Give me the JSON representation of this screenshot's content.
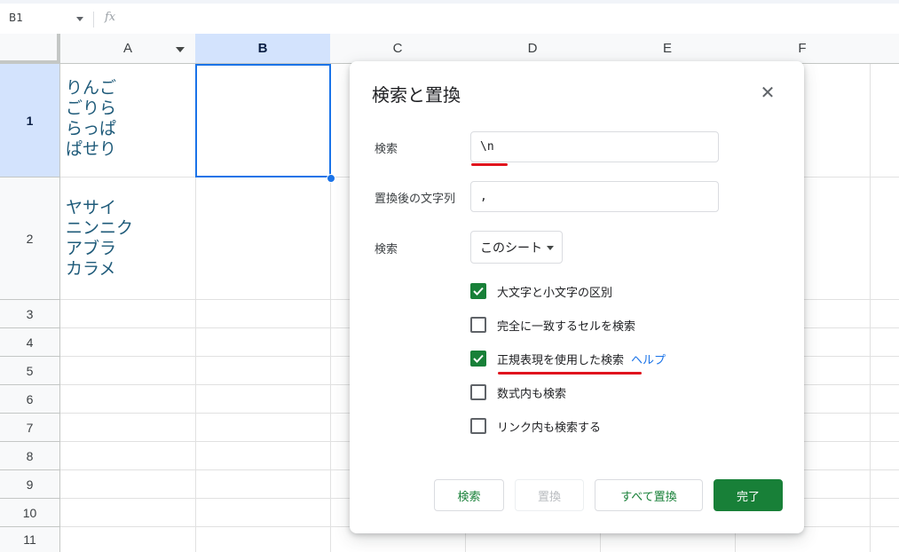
{
  "formula_bar": {
    "cell_ref": "B1",
    "fx_label": "fx"
  },
  "columns": [
    "A",
    "B",
    "C",
    "D",
    "E",
    "F"
  ],
  "rows": [
    "1",
    "2",
    "3",
    "4",
    "5",
    "6",
    "7",
    "8",
    "9",
    "10",
    "11"
  ],
  "selected": {
    "column": "B",
    "row": "1"
  },
  "cells": {
    "A1": [
      "りんご",
      "ごりら",
      "らっぱ",
      "ぱせり"
    ],
    "A2": [
      "ヤサイ",
      "ニンニク",
      "アブラ",
      "カラメ"
    ]
  },
  "dialog": {
    "title": "検索と置換",
    "find_label": "検索",
    "find_value": "\\n",
    "replace_label": "置換後の文字列",
    "replace_value": ",",
    "scope_label": "検索",
    "scope_value": "このシート",
    "options": [
      {
        "label": "大文字と小文字の区別",
        "checked": true
      },
      {
        "label": "完全に一致するセルを検索",
        "checked": false
      },
      {
        "label": "正規表現を使用した検索",
        "checked": true,
        "link": "ヘルプ"
      },
      {
        "label": "数式内も検索",
        "checked": false
      },
      {
        "label": "リンク内も検索する",
        "checked": false
      }
    ],
    "buttons": {
      "find": "検索",
      "replace": "置換",
      "replace_all": "すべて置換",
      "done": "完了"
    }
  },
  "colors": {
    "accent_green": "#188038",
    "selection_blue": "#1a73e8",
    "annotation_red": "#e0141e"
  }
}
